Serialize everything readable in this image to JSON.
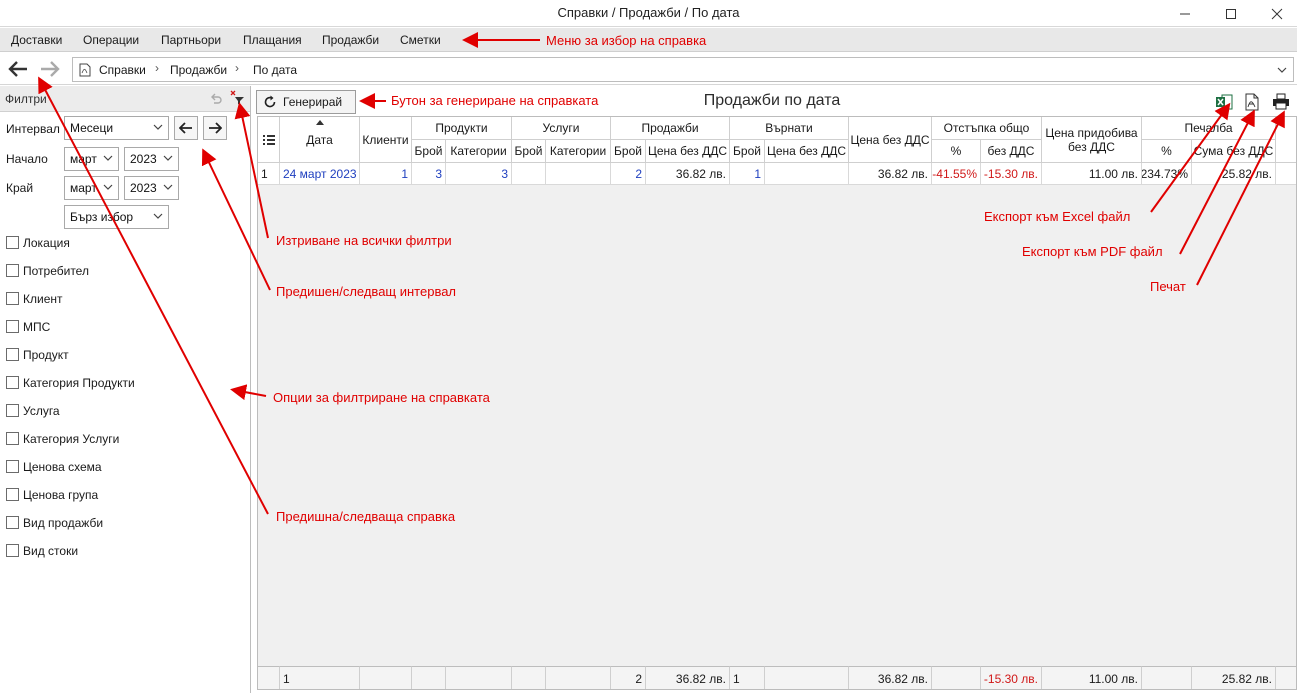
{
  "window": {
    "title": "Справки / Продажби / По дата"
  },
  "menu": {
    "items": [
      "Доставки",
      "Операции",
      "Партньори",
      "Плащания",
      "Продажби",
      "Сметки"
    ]
  },
  "breadcrumb": {
    "items": [
      "Справки",
      "Продажби",
      "По дата"
    ]
  },
  "filters": {
    "header": "Филтри",
    "interval_label": "Интервал",
    "interval_value": "Месеци",
    "start_label": "Начало",
    "start_month": "март",
    "start_year": "2023",
    "end_label": "Край",
    "end_month": "март",
    "end_year": "2023",
    "quick_select": "Бърз избор",
    "checkboxes": [
      "Локация",
      "Потребител",
      "Клиент",
      "МПС",
      "Продукт",
      "Категория Продукти",
      "Услуга",
      "Категория Услуги",
      "Ценова схема",
      "Ценова група",
      "Вид продажби",
      "Вид стоки"
    ]
  },
  "toolbar": {
    "generate_label": "Генерирай"
  },
  "report": {
    "title": "Продажби по дата"
  },
  "table": {
    "headers": {
      "date": "Дата",
      "clients": "Клиенти",
      "products": "Продукти",
      "services": "Услуги",
      "sales": "Продажби",
      "returned": "Върнати",
      "price_no_vat": "Цена без ДДС",
      "discount_total": "Отстъпка общо",
      "cost_price": "Цена придобива без ДДС",
      "profit": "Печалба",
      "count": "Брой",
      "categories": "Категории",
      "price_sub": "Цена без ДДС",
      "percent": "%",
      "no_vat": "без ДДС",
      "sum_no_vat": "Сума без ДДС"
    },
    "row": {
      "num": "1",
      "date": "24 март 2023",
      "clients": "1",
      "prod_count": "3",
      "prod_categories": "3",
      "srv_count": "",
      "srv_categories": "",
      "sales_count": "2",
      "sales_price": "36.82 лв.",
      "ret_count": "1",
      "ret_price": "",
      "price": "36.82 лв.",
      "disc_pct": "-41.55%",
      "disc_amount": "-15.30 лв.",
      "cost": "11.00 лв.",
      "profit_pct": "234.73%",
      "profit_sum": "25.82 лв."
    },
    "footer": {
      "num": "1",
      "sales_count": "2",
      "sales_price": "36.82 лв.",
      "ret_count": "1",
      "price": "36.82 лв.",
      "disc_amount": "-15.30 лв.",
      "cost": "11.00 лв.",
      "profit_sum": "25.82 лв."
    }
  },
  "annotations": {
    "menu": "Меню за избор на справка",
    "generate": "Бутон за генериране на справката",
    "clear_filters": "Изтриване на всички филтри",
    "prev_next_interval": "Предишен/следващ интервал",
    "filter_options": "Опции за филтриране на справката",
    "prev_next_report": "Предишна/следваща справка",
    "excel": "Експорт към Excel файл",
    "pdf": "Експорт към PDF файл",
    "print": "Печат"
  },
  "colors": {
    "annotation": "#e00000",
    "link": "#1f3fbf",
    "negative": "#d01818"
  }
}
